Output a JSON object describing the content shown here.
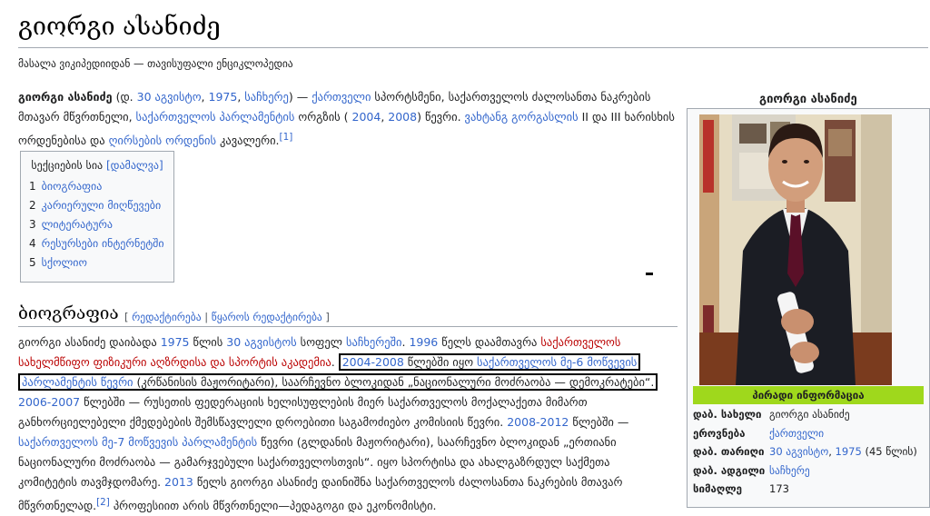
{
  "title": "გიორგი ასანიძე",
  "tagline": "მასალა ვიკიპედიიდან — თავისუფალი ენციკლოპედია",
  "intro": {
    "l1_a": "გიორგი ასანიძე",
    "l1_b": " (დ. ",
    "l1_c": "30 აგვისტო",
    "l1_d": ", ",
    "l1_e": "1975",
    "l1_f": ", ",
    "l1_g": "საჩხერე",
    "l1_h": ") — ",
    "l1_i": "ქართველი",
    "l1_j": " სპორტსმენი, საქართველოს ძალოსანთა ნაკრების",
    "l2_a": "მთავარ მწვრთნელი, ",
    "l2_b": "საქართველოს პარლამენტის",
    "l2_c": " ორგზის ( ",
    "l2_d": "2004",
    "l2_e": ", ",
    "l2_f": "2008",
    "l2_g": ") წევრი. ",
    "l2_h": "ვახტანგ გორგასლის",
    "l2_i": " II და III ხარისხის",
    "l3_a": "ორდენებისა და ",
    "l3_b": "ღირსების ორდენის",
    "l3_c": " კავალერი.",
    "l3_ref": "[1]"
  },
  "toc": {
    "title": "სექციების სია",
    "hide": "[დამალვა]",
    "items": [
      {
        "num": "1",
        "label": "ბიოგრაფია"
      },
      {
        "num": "2",
        "label": "კარიერული მიღწევები"
      },
      {
        "num": "3",
        "label": "ლიტერატურა"
      },
      {
        "num": "4",
        "label": "რესურსები ინტერნეტში"
      },
      {
        "num": "5",
        "label": "სქოლიო"
      }
    ]
  },
  "section": {
    "title": "ბიოგრაფია",
    "edit_open": "[ ",
    "edit": "რედაქტირება",
    "sep": " | ",
    "edit_source": "წყაროს რედაქტირება",
    "edit_close": " ]"
  },
  "bio": {
    "b1_a": "გიორგი ასანიძე დაიბადა ",
    "b1_b": "1975",
    "b1_c": " წლის ",
    "b1_d": "30 აგვისტოს",
    "b1_e": " სოფელ ",
    "b1_f": "საჩხერეში",
    "b1_g": ". ",
    "b1_h": "1996",
    "b1_i": " წელს დაამთავრა ",
    "b1_j": "საქართველოს",
    "b2_a": "სახელმწიფო ფიზიკური აღზრდისა და სპორტის აკადემია",
    "b2_b": ". ",
    "b2_c": "2004-2008",
    "b2_d": " წლებში იყო ",
    "b2_e": "საქართველოს მე-6 მოწვევის",
    "b3_a": "პარლამენტის წევრი",
    "b3_b": " (კრწანისის მაჟორიტარი), საარჩევნო ბლოკიდან „ნაციონალური მოძრაობა — დემოკრატები“.",
    "b4_a": "2006-2007",
    "b4_b": " წლებში — რუსეთის ფედერაციის ხელისუფლების მიერ საქართველოს მოქალაქეთა მიმართ",
    "b5_a": "განხორციელებელი ქმედებების შემსწავლელი დროებითი საგამოძიებო კომისიის წევრი. ",
    "b5_b": "2008-2012",
    "b5_c": " წლებში —",
    "b6_a": "საქართველოს მე-7 მოწვევის პარლამენტის",
    "b6_b": " წევრი (გლდანის მაჟორიტარი), საარჩევნო ბლოკიდან „ერთიანი",
    "b7_a": "ნაციონალური მოძრაობა — გამარჯვებული საქართველოსთვის“. იყო სპორტისა და ახალგაზრდულ საქმეთა",
    "b8_a": "კომიტეტის თავმჯდომარე. ",
    "b8_b": "2013",
    "b8_c": " წელს გიორგი ასანიძე დაინიშნა საქართველოს ძალოსანთა ნაკრების მთავარ",
    "b9_a": "მწვრთნელად.",
    "b9_ref": "[2]",
    "b9_b": " პროფესიით არის მწვრთნელი—პედაგოგი და ეკონომისტი."
  },
  "infobox": {
    "title": "გიორგი ასანიძე",
    "header": "პირადი ინფორმაცია",
    "rows": [
      {
        "key": "დაბ. სახელი",
        "value": "გიორგი ასანიძე"
      },
      {
        "key": "ეროვნება",
        "value": "ქართველი"
      },
      {
        "key": "დაბ. თარიღი",
        "value_a": "30 აგვისტო",
        "value_b": ", ",
        "value_c": "1975",
        "value_d": " (45 წლის)"
      },
      {
        "key": "დაბ. ადგილი",
        "value": "საჩხერე"
      },
      {
        "key": "სიმაღლე",
        "value": "173"
      }
    ]
  },
  "colors": {
    "link": "#3366cc",
    "redlink": "#ba0000",
    "infobox_header": "#9fd81c"
  }
}
